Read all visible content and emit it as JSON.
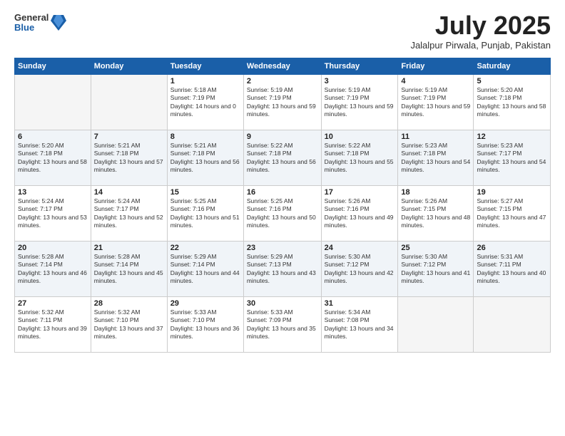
{
  "logo": {
    "general": "General",
    "blue": "Blue"
  },
  "title": "July 2025",
  "location": "Jalalpur Pirwala, Punjab, Pakistan",
  "days_of_week": [
    "Sunday",
    "Monday",
    "Tuesday",
    "Wednesday",
    "Thursday",
    "Friday",
    "Saturday"
  ],
  "weeks": [
    [
      {
        "day": "",
        "empty": true
      },
      {
        "day": "",
        "empty": true
      },
      {
        "day": "1",
        "sunrise": "Sunrise: 5:18 AM",
        "sunset": "Sunset: 7:19 PM",
        "daylight": "Daylight: 14 hours and 0 minutes."
      },
      {
        "day": "2",
        "sunrise": "Sunrise: 5:19 AM",
        "sunset": "Sunset: 7:19 PM",
        "daylight": "Daylight: 13 hours and 59 minutes."
      },
      {
        "day": "3",
        "sunrise": "Sunrise: 5:19 AM",
        "sunset": "Sunset: 7:19 PM",
        "daylight": "Daylight: 13 hours and 59 minutes."
      },
      {
        "day": "4",
        "sunrise": "Sunrise: 5:19 AM",
        "sunset": "Sunset: 7:19 PM",
        "daylight": "Daylight: 13 hours and 59 minutes."
      },
      {
        "day": "5",
        "sunrise": "Sunrise: 5:20 AM",
        "sunset": "Sunset: 7:18 PM",
        "daylight": "Daylight: 13 hours and 58 minutes."
      }
    ],
    [
      {
        "day": "6",
        "sunrise": "Sunrise: 5:20 AM",
        "sunset": "Sunset: 7:18 PM",
        "daylight": "Daylight: 13 hours and 58 minutes."
      },
      {
        "day": "7",
        "sunrise": "Sunrise: 5:21 AM",
        "sunset": "Sunset: 7:18 PM",
        "daylight": "Daylight: 13 hours and 57 minutes."
      },
      {
        "day": "8",
        "sunrise": "Sunrise: 5:21 AM",
        "sunset": "Sunset: 7:18 PM",
        "daylight": "Daylight: 13 hours and 56 minutes."
      },
      {
        "day": "9",
        "sunrise": "Sunrise: 5:22 AM",
        "sunset": "Sunset: 7:18 PM",
        "daylight": "Daylight: 13 hours and 56 minutes."
      },
      {
        "day": "10",
        "sunrise": "Sunrise: 5:22 AM",
        "sunset": "Sunset: 7:18 PM",
        "daylight": "Daylight: 13 hours and 55 minutes."
      },
      {
        "day": "11",
        "sunrise": "Sunrise: 5:23 AM",
        "sunset": "Sunset: 7:18 PM",
        "daylight": "Daylight: 13 hours and 54 minutes."
      },
      {
        "day": "12",
        "sunrise": "Sunrise: 5:23 AM",
        "sunset": "Sunset: 7:17 PM",
        "daylight": "Daylight: 13 hours and 54 minutes."
      }
    ],
    [
      {
        "day": "13",
        "sunrise": "Sunrise: 5:24 AM",
        "sunset": "Sunset: 7:17 PM",
        "daylight": "Daylight: 13 hours and 53 minutes."
      },
      {
        "day": "14",
        "sunrise": "Sunrise: 5:24 AM",
        "sunset": "Sunset: 7:17 PM",
        "daylight": "Daylight: 13 hours and 52 minutes."
      },
      {
        "day": "15",
        "sunrise": "Sunrise: 5:25 AM",
        "sunset": "Sunset: 7:16 PM",
        "daylight": "Daylight: 13 hours and 51 minutes."
      },
      {
        "day": "16",
        "sunrise": "Sunrise: 5:25 AM",
        "sunset": "Sunset: 7:16 PM",
        "daylight": "Daylight: 13 hours and 50 minutes."
      },
      {
        "day": "17",
        "sunrise": "Sunrise: 5:26 AM",
        "sunset": "Sunset: 7:16 PM",
        "daylight": "Daylight: 13 hours and 49 minutes."
      },
      {
        "day": "18",
        "sunrise": "Sunrise: 5:26 AM",
        "sunset": "Sunset: 7:15 PM",
        "daylight": "Daylight: 13 hours and 48 minutes."
      },
      {
        "day": "19",
        "sunrise": "Sunrise: 5:27 AM",
        "sunset": "Sunset: 7:15 PM",
        "daylight": "Daylight: 13 hours and 47 minutes."
      }
    ],
    [
      {
        "day": "20",
        "sunrise": "Sunrise: 5:28 AM",
        "sunset": "Sunset: 7:14 PM",
        "daylight": "Daylight: 13 hours and 46 minutes."
      },
      {
        "day": "21",
        "sunrise": "Sunrise: 5:28 AM",
        "sunset": "Sunset: 7:14 PM",
        "daylight": "Daylight: 13 hours and 45 minutes."
      },
      {
        "day": "22",
        "sunrise": "Sunrise: 5:29 AM",
        "sunset": "Sunset: 7:14 PM",
        "daylight": "Daylight: 13 hours and 44 minutes."
      },
      {
        "day": "23",
        "sunrise": "Sunrise: 5:29 AM",
        "sunset": "Sunset: 7:13 PM",
        "daylight": "Daylight: 13 hours and 43 minutes."
      },
      {
        "day": "24",
        "sunrise": "Sunrise: 5:30 AM",
        "sunset": "Sunset: 7:12 PM",
        "daylight": "Daylight: 13 hours and 42 minutes."
      },
      {
        "day": "25",
        "sunrise": "Sunrise: 5:30 AM",
        "sunset": "Sunset: 7:12 PM",
        "daylight": "Daylight: 13 hours and 41 minutes."
      },
      {
        "day": "26",
        "sunrise": "Sunrise: 5:31 AM",
        "sunset": "Sunset: 7:11 PM",
        "daylight": "Daylight: 13 hours and 40 minutes."
      }
    ],
    [
      {
        "day": "27",
        "sunrise": "Sunrise: 5:32 AM",
        "sunset": "Sunset: 7:11 PM",
        "daylight": "Daylight: 13 hours and 39 minutes."
      },
      {
        "day": "28",
        "sunrise": "Sunrise: 5:32 AM",
        "sunset": "Sunset: 7:10 PM",
        "daylight": "Daylight: 13 hours and 37 minutes."
      },
      {
        "day": "29",
        "sunrise": "Sunrise: 5:33 AM",
        "sunset": "Sunset: 7:10 PM",
        "daylight": "Daylight: 13 hours and 36 minutes."
      },
      {
        "day": "30",
        "sunrise": "Sunrise: 5:33 AM",
        "sunset": "Sunset: 7:09 PM",
        "daylight": "Daylight: 13 hours and 35 minutes."
      },
      {
        "day": "31",
        "sunrise": "Sunrise: 5:34 AM",
        "sunset": "Sunset: 7:08 PM",
        "daylight": "Daylight: 13 hours and 34 minutes."
      },
      {
        "day": "",
        "empty": true
      },
      {
        "day": "",
        "empty": true
      }
    ]
  ]
}
